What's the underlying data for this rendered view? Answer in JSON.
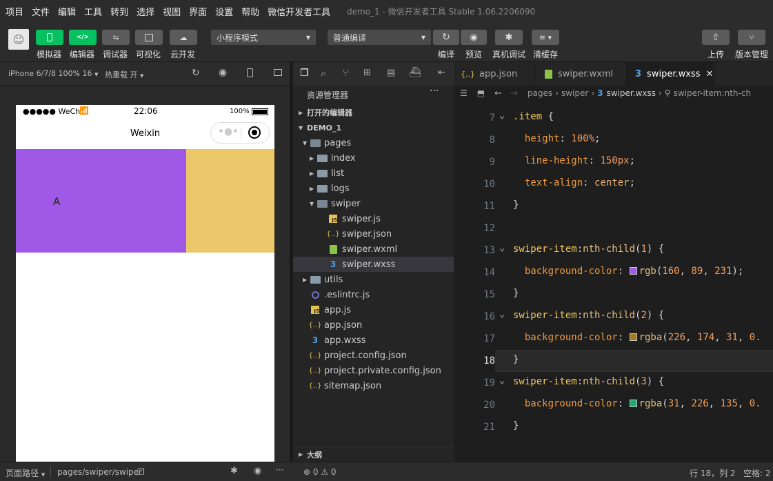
{
  "menu": [
    "项目",
    "文件",
    "编辑",
    "工具",
    "转到",
    "选择",
    "视图",
    "界面",
    "设置",
    "帮助",
    "微信开发者工具"
  ],
  "window_title": "demo_1 - 微信开发者工具 Stable 1.06.2206090",
  "toolbar": {
    "simulator": "模拟器",
    "editor": "编辑器",
    "debugger": "调试器",
    "visual": "可视化",
    "cloud": "云开发",
    "mode_select": "小程序模式",
    "compile_select": "普通编译",
    "compile": "编译",
    "preview": "预览",
    "real_debug": "真机调试",
    "clear_cache": "清缓存",
    "upload": "上传",
    "version": "版本管理",
    "editor_glyph": "</>"
  },
  "simulator": {
    "device": "iPhone 6/7/8 100% 16",
    "hot_reload": "热重载 开",
    "status_carrier": "●●●●● WeChat",
    "status_time": "22:06",
    "status_battery": "100%",
    "nav_title": "Weixin",
    "swiper_label": "A",
    "swiper_colors": [
      "#a059e7",
      "#ecc76a"
    ]
  },
  "explorer": {
    "title": "资源管理器",
    "open_editors": "打开的编辑器",
    "project": "DEMO_1",
    "outline": "大纲",
    "items": [
      {
        "label": "pages",
        "depth": 1,
        "kind": "folder-open",
        "expanded": true
      },
      {
        "label": "index",
        "depth": 2,
        "kind": "folder",
        "expanded": false
      },
      {
        "label": "list",
        "depth": 2,
        "kind": "folder",
        "expanded": false
      },
      {
        "label": "logs",
        "depth": 2,
        "kind": "folder",
        "expanded": false
      },
      {
        "label": "swiper",
        "depth": 2,
        "kind": "folder-open",
        "expanded": true
      },
      {
        "label": "swiper.js",
        "depth": 3,
        "kind": "js"
      },
      {
        "label": "swiper.json",
        "depth": 3,
        "kind": "json"
      },
      {
        "label": "swiper.wxml",
        "depth": 3,
        "kind": "wxml"
      },
      {
        "label": "swiper.wxss",
        "depth": 3,
        "kind": "wxss",
        "selected": true
      },
      {
        "label": "utils",
        "depth": 1,
        "kind": "folder",
        "expanded": false
      },
      {
        "label": ".eslintrc.js",
        "depth": 1,
        "kind": "eslint"
      },
      {
        "label": "app.js",
        "depth": 1,
        "kind": "js"
      },
      {
        "label": "app.json",
        "depth": 1,
        "kind": "json"
      },
      {
        "label": "app.wxss",
        "depth": 1,
        "kind": "wxss"
      },
      {
        "label": "project.config.json",
        "depth": 1,
        "kind": "json"
      },
      {
        "label": "project.private.config.json",
        "depth": 1,
        "kind": "json"
      },
      {
        "label": "sitemap.json",
        "depth": 1,
        "kind": "json"
      }
    ]
  },
  "tabs": [
    {
      "label": "app.json",
      "icon": "{..}",
      "active": false
    },
    {
      "label": "swiper.wxml",
      "icon": "wxml-icon",
      "active": false
    },
    {
      "label": "swiper.wxss",
      "icon": "wxss-icon",
      "active": true
    }
  ],
  "breadcrumb": [
    "pages",
    "swiper",
    "swiper.wxss",
    "swiper-item:nth-ch"
  ],
  "code_lines": [
    {
      "n": "7",
      "fold": true,
      "parts": [
        [
          "sel-c",
          ".item"
        ],
        [
          "brace",
          " {"
        ]
      ]
    },
    {
      "n": "8",
      "parts": [
        [
          "brace",
          "  "
        ],
        [
          "prop",
          "height"
        ],
        [
          "brace",
          ": "
        ],
        [
          "num",
          "100%"
        ],
        [
          "brace",
          ";"
        ]
      ]
    },
    {
      "n": "9",
      "parts": [
        [
          "brace",
          "  "
        ],
        [
          "prop",
          "line-height"
        ],
        [
          "brace",
          ": "
        ],
        [
          "num",
          "150px"
        ],
        [
          "brace",
          ";"
        ]
      ]
    },
    {
      "n": "10",
      "parts": [
        [
          "brace",
          "  "
        ],
        [
          "prop",
          "text-align"
        ],
        [
          "brace",
          ": "
        ],
        [
          "val",
          "center"
        ],
        [
          "brace",
          ";"
        ]
      ]
    },
    {
      "n": "11",
      "parts": [
        [
          "brace",
          "}"
        ]
      ]
    },
    {
      "n": "12",
      "parts": []
    },
    {
      "n": "13",
      "fold": true,
      "parts": [
        [
          "sel-c",
          "swiper-item"
        ],
        [
          "brace",
          ":"
        ],
        [
          "fn",
          "nth-child"
        ],
        [
          "brace",
          "("
        ],
        [
          "num",
          "1"
        ],
        [
          "brace",
          ") {"
        ]
      ]
    },
    {
      "n": "14",
      "swatch": "#a059e7",
      "parts": [
        [
          "brace",
          "  "
        ],
        [
          "prop",
          "background-color"
        ],
        [
          "brace",
          ": "
        ],
        [
          "swatch",
          ""
        ],
        [
          "fn",
          "rgb"
        ],
        [
          "brace",
          "("
        ],
        [
          "num",
          "160"
        ],
        [
          "brace",
          ", "
        ],
        [
          "num",
          "89"
        ],
        [
          "brace",
          ", "
        ],
        [
          "num",
          "231"
        ],
        [
          "brace",
          ");"
        ]
      ]
    },
    {
      "n": "15",
      "parts": [
        [
          "brace",
          "}"
        ]
      ]
    },
    {
      "n": "16",
      "fold": true,
      "parts": [
        [
          "sel-c",
          "swiper-item"
        ],
        [
          "brace",
          ":"
        ],
        [
          "fn",
          "nth-child"
        ],
        [
          "brace",
          "("
        ],
        [
          "num",
          "2"
        ],
        [
          "brace",
          ") {"
        ]
      ]
    },
    {
      "n": "17",
      "swatch": "#a37a1f",
      "parts": [
        [
          "brace",
          "  "
        ],
        [
          "prop",
          "background-color"
        ],
        [
          "brace",
          ": "
        ],
        [
          "swatch",
          ""
        ],
        [
          "fn",
          "rgba"
        ],
        [
          "brace",
          "("
        ],
        [
          "num",
          "226"
        ],
        [
          "brace",
          ", "
        ],
        [
          "num",
          "174"
        ],
        [
          "brace",
          ", "
        ],
        [
          "num",
          "31"
        ],
        [
          "brace",
          ", "
        ],
        [
          "num",
          "0."
        ]
      ]
    },
    {
      "n": "18",
      "cur": true,
      "parts": [
        [
          "brace",
          "}"
        ]
      ]
    },
    {
      "n": "19",
      "fold": true,
      "parts": [
        [
          "sel-c",
          "swiper-item"
        ],
        [
          "brace",
          ":"
        ],
        [
          "fn",
          "nth-child"
        ],
        [
          "brace",
          "("
        ],
        [
          "num",
          "3"
        ],
        [
          "brace",
          ") {"
        ]
      ]
    },
    {
      "n": "20",
      "swatch": "#1fa870",
      "parts": [
        [
          "brace",
          "  "
        ],
        [
          "prop",
          "background-color"
        ],
        [
          "brace",
          ": "
        ],
        [
          "swatch",
          ""
        ],
        [
          "fn",
          "rgba"
        ],
        [
          "brace",
          "("
        ],
        [
          "num",
          "31"
        ],
        [
          "brace",
          ", "
        ],
        [
          "num",
          "226"
        ],
        [
          "brace",
          ", "
        ],
        [
          "num",
          "135"
        ],
        [
          "brace",
          ", "
        ],
        [
          "num",
          "0."
        ]
      ]
    },
    {
      "n": "21",
      "parts": [
        [
          "brace",
          "}"
        ]
      ]
    }
  ],
  "bottom": {
    "page_path_label": "页面路径",
    "page_path": "pages/swiper/swiper",
    "errors": "⊗ 0 ⚠ 0",
    "cursor": "行 18，列 2",
    "indent": "空格: 2"
  },
  "colors": {
    "accent": "#07c160",
    "editor_bg": "#1e1e1e",
    "sidebar_bg": "#252526"
  }
}
